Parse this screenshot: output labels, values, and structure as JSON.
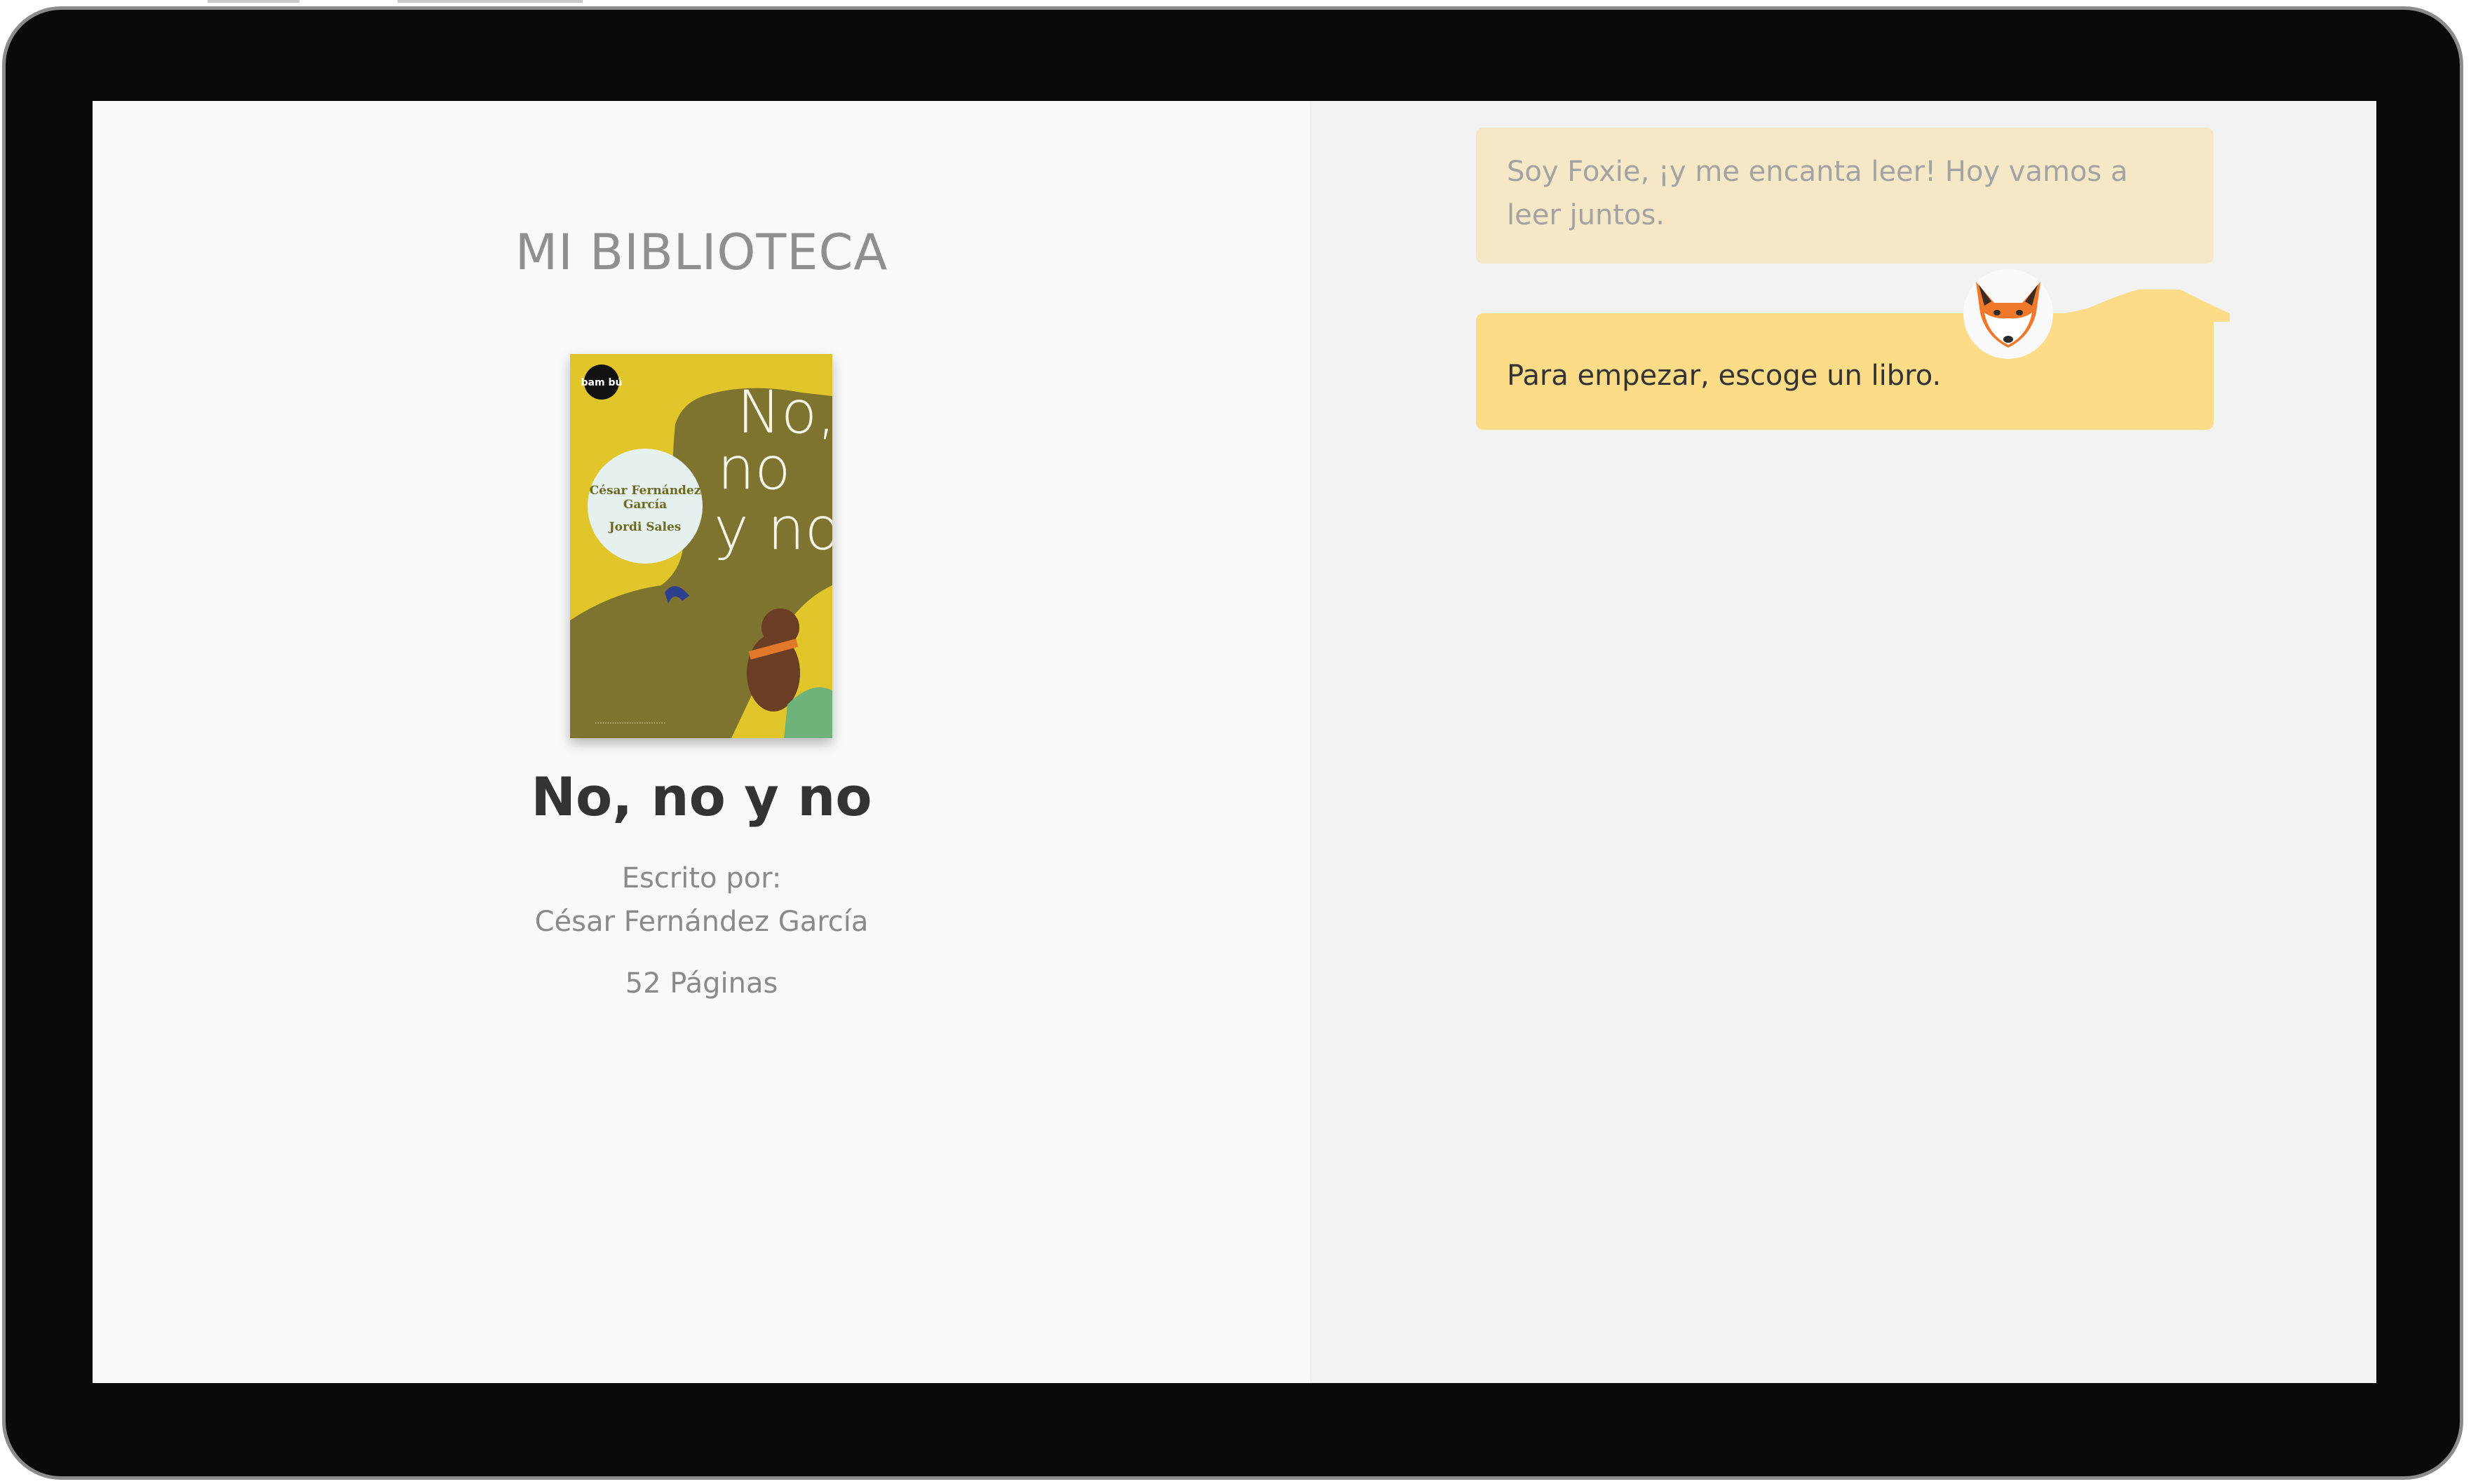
{
  "library": {
    "title": "MI BIBLIOTECA"
  },
  "book": {
    "title": "No, no y no",
    "written_by_label": "Escrito por:",
    "author": "César Fernández García",
    "pages": "52 Páginas",
    "cover": {
      "title_lines": [
        "No,",
        "no",
        "y no"
      ],
      "author_lines": [
        "César Fernández",
        "García",
        "Jordi Sales"
      ],
      "publisher": "bam bú",
      "colors": {
        "background": "#e0c62b",
        "shadow": "#7f7330",
        "circle": "#e6f0ee"
      }
    }
  },
  "chat": {
    "message_1": "Soy Foxie, ¡y me encanta leer! Hoy vamos a leer juntos.",
    "message_2": "Para empezar, escoge un libro.",
    "avatar": "fox-icon",
    "colors": {
      "bubble_old": "#f6e8c7",
      "bubble_current": "#fddc88"
    }
  }
}
